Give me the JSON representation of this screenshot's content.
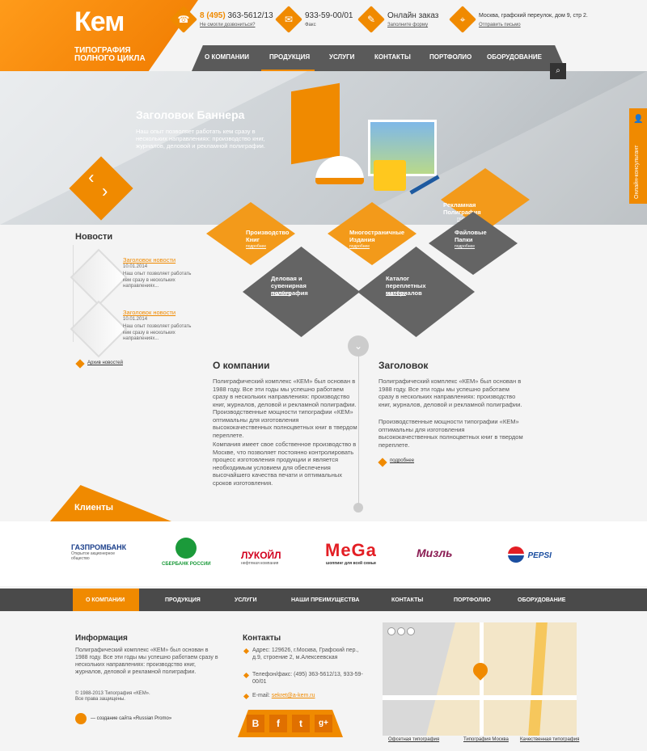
{
  "header": {
    "logo": "Кем",
    "logo_sub1": "Типография",
    "logo_sub2": "полного цикла",
    "phone": {
      "code": "8 (495)",
      "number": "363-5612/13",
      "link": "Не смогли дозвониться?"
    },
    "fax": {
      "number": "933-59-00/01",
      "label": "Факс"
    },
    "order": {
      "title": "Онлайн заказ",
      "link": "Заполните форму"
    },
    "address": {
      "text": "Москва, графский переулок, дом 9, стр 2.",
      "link": "Отправить письмо"
    }
  },
  "nav": [
    "О компании",
    "Продукция",
    "Услуги",
    "Контакты",
    "Портфолио",
    "Оборудование"
  ],
  "banner": {
    "title": "Заголовок Баннера",
    "text": "Наш опыт позволяет работать кем сразу в нескольких направлениях: производство книг, журналов, деловой и рекламной полиграфии."
  },
  "side_tab": "Онлайн-консультант",
  "products": [
    {
      "title": "Рекламная Полиграфия",
      "link": "подробнее"
    },
    {
      "title": "Производство Книг",
      "link": "подробнее"
    },
    {
      "title": "Многостраничные Издания",
      "link": "подробнее"
    },
    {
      "title": "Файловые Папки",
      "link": "подробнее"
    },
    {
      "title": "Деловая и сувенирная полиграфия",
      "link": "подробнее"
    },
    {
      "title": "Каталог переплетных материалов",
      "link": "подробнее"
    }
  ],
  "news": {
    "title": "Новости",
    "items": [
      {
        "title": "Заголовок новости",
        "date": "10.01.2014",
        "text": "Наш опыт позволяет работать кем сразу в нескольких направлениях..."
      },
      {
        "title": "Заголовок новости",
        "date": "10.01.2014",
        "text": "Наш опыт позволяет работать кем сразу в нескольких направлениях..."
      }
    ],
    "archive": "Архив новостей"
  },
  "about": {
    "title": "О компании",
    "p1": "Полиграфический комплекс «КЕМ» был основан в 1988 году. Все эти годы мы успешно работаем сразу в нескольких направлениях: производство книг, журналов, деловой и рекламной полиграфии. Производственные мощности типографии «КЕМ» оптимальны для изготовления высококачественных полноцветных книг в твердом переплете.",
    "p2": "Компания имеет свое собственное производство в Москве, что позволяет постоянно контролировать процесс изготовления продукции и является необходимым условием для обеспечения высочайшего качества печати и оптимальных сроков изготовления."
  },
  "heading2": {
    "title": "Заголовок",
    "p1": "Полиграфический комплекс «КЕМ» был основан в 1988 году. Все эти годы мы успешно работаем сразу в нескольких направлениях: производство книг, журналов, деловой и рекламной полиграфии.",
    "p2": "Производственные мощности типографии «КЕМ» оптимальны для изготовления высококачественных полноцветных книг в твердом переплете.",
    "more": "подробнее"
  },
  "clients": {
    "title": "Клиенты",
    "logos": [
      {
        "name": "ГАЗПРОМБАНК",
        "sub": "Открытое акционерное общество"
      },
      {
        "name": "СБЕРБАНК РОССИИ",
        "sub": ""
      },
      {
        "name": "ЛУКОЙЛ",
        "sub": "нефтяная компания"
      },
      {
        "name": "MeGa",
        "sub": "шоппинг для всей семьи"
      },
      {
        "name": "Мизль",
        "sub": ""
      },
      {
        "name": "PEPSI",
        "sub": ""
      }
    ]
  },
  "footer_nav": [
    "О компании",
    "Продукция",
    "Услуги",
    "Наши преимущества",
    "Контакты",
    "Портфолио",
    "Оборудование"
  ],
  "footer": {
    "info_title": "Информация",
    "info_text": "Полиграфический комплекс «КЕМ» был основан в 1988 году. Все эти годы мы успешно работаем сразу в нескольких направлениях: производство книг, журналов, деловой и рекламной полиграфии.",
    "copyright": "© 1988-2013 Типография «КЕМ».",
    "rights": "Все права защищены.",
    "credit": "— создание сайта «Russian Promo»",
    "contacts_title": "Контакты",
    "address": "Адрес: 129626, г.Москва, Графский пер., д.9, строение 2, м.Алексеевская",
    "phone": "Телефон/факс: (495) 363-5612/13, 933-59-00/01",
    "email_label": "E-mail:",
    "email": "sekret@a-kem.ru",
    "social": [
      "B",
      "f",
      "t",
      "g+"
    ],
    "links": [
      "Офсетная типография",
      "Типография Москва",
      "Качественная типография"
    ]
  },
  "colors": {
    "accent": "#f08a00",
    "dark": "#4a4a4a"
  }
}
